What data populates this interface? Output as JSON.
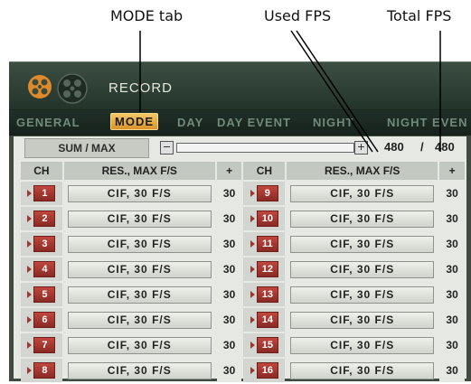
{
  "callouts": {
    "mode_tab": "MODE tab",
    "used_fps": "Used FPS",
    "total_fps": "Total FPS"
  },
  "window": {
    "title": "RECORD"
  },
  "tabs": [
    {
      "label": "GENERAL",
      "active": false
    },
    {
      "label": "MODE",
      "active": true
    },
    {
      "label": "DAY",
      "active": false
    },
    {
      "label": "DAY EVENT",
      "active": false
    },
    {
      "label": "NIGHT",
      "active": false
    },
    {
      "label": "NIGHT EVEN",
      "active": false
    }
  ],
  "sum": {
    "label": "SUM / MAX",
    "minus": "−",
    "plus": "+",
    "used": "480",
    "sep": "/",
    "total": "480"
  },
  "table": {
    "headers": [
      "CH",
      "RES., MAX F/S",
      "+",
      "CH",
      "RES., MAX F/S",
      "+"
    ],
    "rows": [
      {
        "left": {
          "ch": "1",
          "res": "CIF, 30 F/S",
          "fps": "30"
        },
        "right": {
          "ch": "9",
          "res": "CIF, 30 F/S",
          "fps": "30"
        }
      },
      {
        "left": {
          "ch": "2",
          "res": "CIF, 30 F/S",
          "fps": "30"
        },
        "right": {
          "ch": "10",
          "res": "CIF, 30 F/S",
          "fps": "30"
        }
      },
      {
        "left": {
          "ch": "3",
          "res": "CIF, 30 F/S",
          "fps": "30"
        },
        "right": {
          "ch": "11",
          "res": "CIF, 30 F/S",
          "fps": "30"
        }
      },
      {
        "left": {
          "ch": "4",
          "res": "CIF, 30 F/S",
          "fps": "30"
        },
        "right": {
          "ch": "12",
          "res": "CIF, 30 F/S",
          "fps": "30"
        }
      },
      {
        "left": {
          "ch": "5",
          "res": "CIF, 30 F/S",
          "fps": "30"
        },
        "right": {
          "ch": "13",
          "res": "CIF, 30 F/S",
          "fps": "30"
        }
      },
      {
        "left": {
          "ch": "6",
          "res": "CIF, 30 F/S",
          "fps": "30"
        },
        "right": {
          "ch": "14",
          "res": "CIF, 30 F/S",
          "fps": "30"
        }
      },
      {
        "left": {
          "ch": "7",
          "res": "CIF, 30 F/S",
          "fps": "30"
        },
        "right": {
          "ch": "15",
          "res": "CIF, 30 F/S",
          "fps": "30"
        }
      },
      {
        "left": {
          "ch": "8",
          "res": "CIF, 30 F/S",
          "fps": "30"
        },
        "right": {
          "ch": "16",
          "res": "CIF, 30 F/S",
          "fps": "30"
        }
      }
    ]
  },
  "colors": {
    "accent_tab": "#e0a23a",
    "channel_badge": "#a8342c",
    "panel_bg": "#e6e8e3",
    "window_bg": "#2b3b31"
  },
  "icons": {
    "logo": "film-reel-icon",
    "channel_marker": "channel-arrow-icon"
  }
}
